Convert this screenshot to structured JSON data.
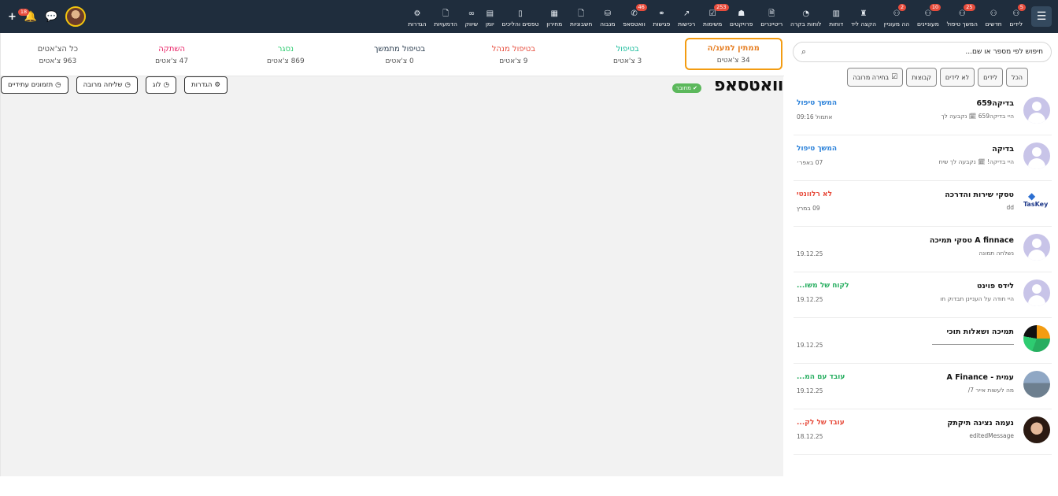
{
  "nav": {
    "items": [
      {
        "label": "לידים",
        "icon": "users-icon",
        "badge": "5"
      },
      {
        "label": "חדשים",
        "icon": "users-icon",
        "badge": ""
      },
      {
        "label": "המשך טיפול",
        "icon": "user-icon",
        "badge": "25"
      },
      {
        "label": "מעוניינים",
        "icon": "user-icon",
        "badge": "10"
      },
      {
        "label": "הה מעוניין",
        "icon": "user-icon",
        "badge": "2"
      },
      {
        "label": "הקצה ליד",
        "icon": "user-tie-icon",
        "badge": ""
      },
      {
        "label": "דוחות",
        "icon": "bar-chart-icon",
        "badge": ""
      },
      {
        "label": "לוחות בקרה",
        "icon": "dashboard-icon",
        "badge": ""
      },
      {
        "label": "ריטיינרים",
        "icon": "file-invoice-icon",
        "badge": ""
      },
      {
        "label": "פרויקטים",
        "icon": "briefcase-icon",
        "badge": ""
      },
      {
        "label": "משימות",
        "icon": "check-square-icon",
        "badge": "253"
      },
      {
        "label": "רכישות",
        "icon": "chart-line-icon",
        "badge": ""
      },
      {
        "label": "פגישות",
        "icon": "handshake-icon",
        "badge": ""
      },
      {
        "label": "וואטסאפ",
        "icon": "whatsapp-icon",
        "badge": "46"
      },
      {
        "label": "מנבוה",
        "icon": "database-icon",
        "badge": ""
      },
      {
        "label": "חשבוניות",
        "icon": "document-icon",
        "badge": ""
      },
      {
        "label": "מחירון",
        "icon": "barcode-icon",
        "badge": ""
      },
      {
        "label": "טפסים והליכים",
        "icon": "form-icon",
        "badge": ""
      },
      {
        "label": "יומן",
        "icon": "calendar-icon",
        "badge": ""
      },
      {
        "label": "שיווק",
        "icon": "link-icon",
        "badge": ""
      },
      {
        "label": "הדמעויות",
        "icon": "file-icon",
        "badge": ""
      },
      {
        "label": "הגדרות",
        "icon": "gear-icon",
        "badge": ""
      }
    ],
    "notif_badge": "18"
  },
  "stats": [
    {
      "title": "ממתין למענ/ה",
      "count": "34 צ'אטים",
      "color": "#e67e22",
      "active": true
    },
    {
      "title": "בטיפול",
      "count": "3 צ'אטים",
      "color": "#1abc9c",
      "active": false
    },
    {
      "title": "בטיפול מנהל",
      "count": "9 צ'אטים",
      "color": "#e74c3c",
      "active": false
    },
    {
      "title": "בטיפול מתמשך",
      "count": "0 צ'אטים",
      "color": "#2c3e50",
      "active": false
    },
    {
      "title": "נסגר",
      "count": "869 צ'אטים",
      "color": "#2ecc71",
      "active": false
    },
    {
      "title": "השתקה",
      "count": "47 צ'אטים",
      "color": "#e91e63",
      "active": false
    },
    {
      "title": "כל הצ'אטים",
      "count": "963 צ'אטים",
      "color": "#555555",
      "active": false
    }
  ],
  "main": {
    "title": "וואטסאפ",
    "connected": "מחובר",
    "actions": {
      "settings": "הגדרות",
      "log": "לוג",
      "bulk": "שליחה מרובה",
      "scheduled": "תזמונים עתידיים"
    }
  },
  "sidebar": {
    "search_placeholder": "חיפוש לפי מספר או שם...",
    "filters": {
      "all": "הכל",
      "leads": "לידים",
      "not_leads": "לא לידים",
      "groups": "קבוצות",
      "multi": "בחירה מרובה"
    },
    "chats": [
      {
        "name": "בדיקה659",
        "sub": "היי בדיקה659 🗓 נקבעה לך",
        "status": "המשך טיפול",
        "status_color": "#2980d9",
        "date": "אתמול 09:16",
        "avatar": "default"
      },
      {
        "name": "בדיקה",
        "sub": "היי בדיקה! 🗓 נקבעה לך שיח",
        "status": "המשך טיפול",
        "status_color": "#2980d9",
        "date": "07 באפר׳",
        "avatar": "default"
      },
      {
        "name": "טסקי שירות והדרכה",
        "sub": "dd",
        "status": "לא רלוונטי",
        "status_color": "#e74c3c",
        "date": "09 במרץ",
        "avatar": "taskey"
      },
      {
        "name": "A finnace טסקי תמיכה",
        "sub": "נשלחה תמונה",
        "status": "",
        "status_color": "#555",
        "date": "19.12.25",
        "avatar": "default"
      },
      {
        "name": "לידס פוינט",
        "sub": "היי חודה על העניינן תבדוק חו",
        "status": "לקוח של משו...",
        "status_color": "#27ae60",
        "date": "19.12.25",
        "avatar": "default"
      },
      {
        "name": "תמיכה ושאלות תוכי",
        "sub": "",
        "status": "",
        "status_color": "#555",
        "date": "19.12.25",
        "avatar": "logo"
      },
      {
        "name": "עמית - A Finance",
        "sub": "מה לעשות אייר 7/",
        "status": "עובד עם המ...",
        "status_color": "#27ae60",
        "date": "19.12.25",
        "avatar": "photo1"
      },
      {
        "name": "נעמה נצינה תיקתק",
        "sub": "editedMessage",
        "status": "עובד של לק...",
        "status_color": "#e74c3c",
        "date": "18.12.25",
        "avatar": "photo2"
      }
    ]
  }
}
